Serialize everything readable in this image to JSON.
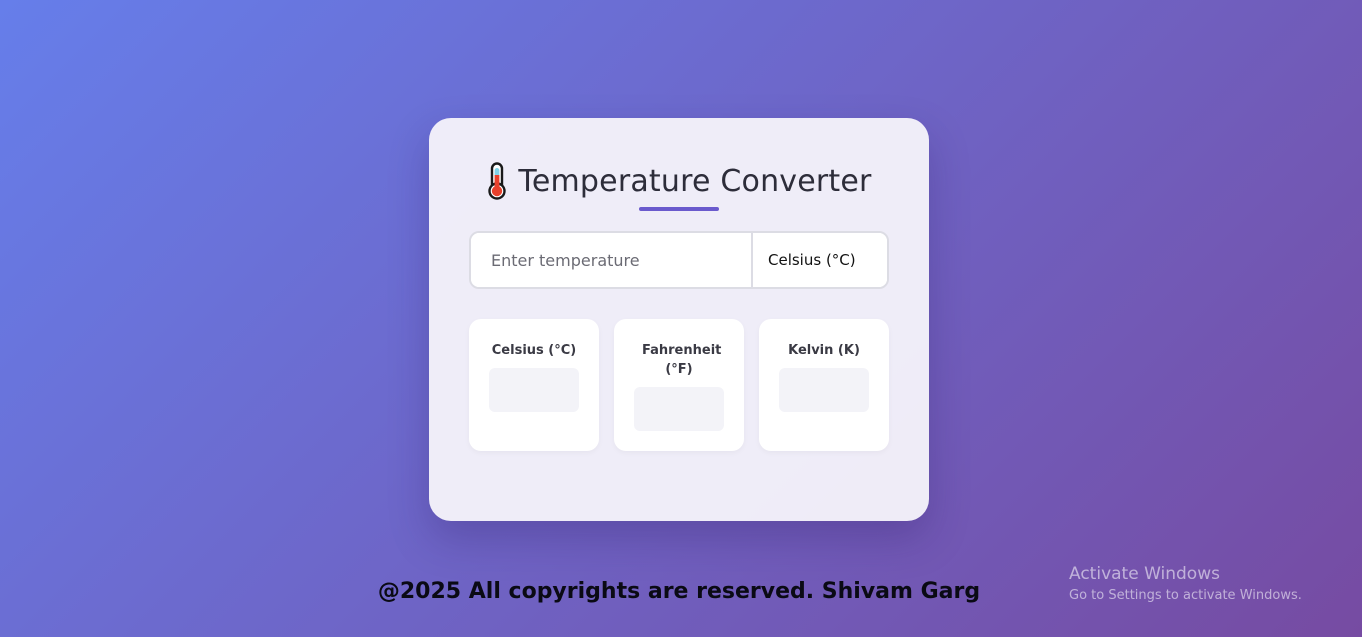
{
  "header": {
    "title": "Temperature Converter",
    "icon": "thermometer-icon"
  },
  "converter": {
    "input_placeholder": "Enter temperature",
    "input_value": "",
    "selected_unit": "Celsius (°C)"
  },
  "results": [
    {
      "label": "Celsius (°C)",
      "value": ""
    },
    {
      "label": "Fahrenheit (°F)",
      "value": ""
    },
    {
      "label": "Kelvin (K)",
      "value": ""
    }
  ],
  "footer": {
    "text": "@2025 All copyrights are reserved. Shivam Garg"
  },
  "watermark": {
    "title": "Activate Windows",
    "subtitle": "Go to Settings to activate Windows."
  },
  "colors": {
    "gradient_start": "#667eea",
    "gradient_end": "#764ba2",
    "accent": "#6a5acd"
  }
}
